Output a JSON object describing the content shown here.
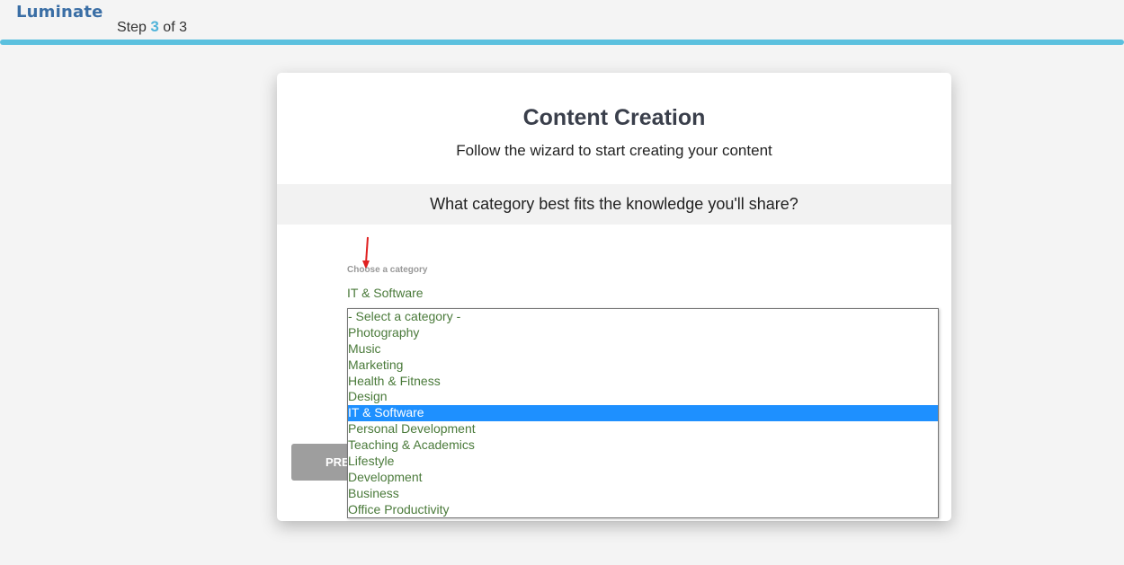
{
  "header": {
    "logo_text": "Luminate",
    "step_prefix": "Step",
    "step_current": "3",
    "step_suffix": "of 3",
    "progress_percent": 100,
    "accent_color": "#5bc0de"
  },
  "card": {
    "title": "Content Creation",
    "subtitle": "Follow the wizard to start creating your content",
    "question": "What category best fits the knowledge you'll share?",
    "field_label": "Choose a category",
    "selected_value": "IT & Software",
    "prev_button_label": "PRE"
  },
  "dropdown": {
    "selected_index": 6,
    "options": [
      "- Select a category -",
      "Photography",
      "Music",
      "Marketing",
      "Health & Fitness",
      "Design",
      "IT & Software",
      "Personal Development",
      "Teaching & Academics",
      "Lifestyle",
      "Development",
      "Business",
      "Office Productivity"
    ],
    "highlight_color": "#1e90ff",
    "text_color": "#4a7a3a"
  },
  "annotation": {
    "arrow_icon": "red-arrow-down-icon",
    "arrow_color": "#e02020"
  }
}
